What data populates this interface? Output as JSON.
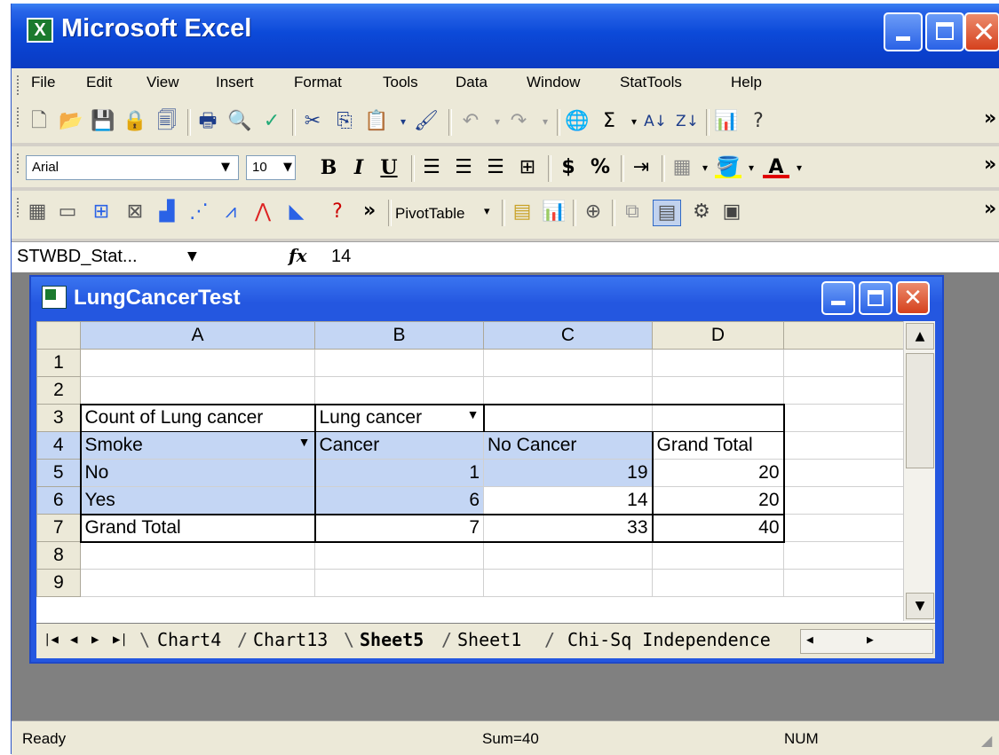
{
  "app": {
    "title": "Microsoft Excel",
    "logo": "X"
  },
  "menu": [
    "File",
    "Edit",
    "View",
    "Insert",
    "Format",
    "Tools",
    "Data",
    "Window",
    "StatTools",
    "Help"
  ],
  "toolbar2": {
    "font": "Arial",
    "size": "10",
    "bold": "B",
    "italic": "I",
    "underline": "U",
    "currency": "$",
    "percent": "%"
  },
  "toolbar3": {
    "pivot_label": "PivotTable"
  },
  "formula_bar": {
    "name_box": "STWBD_Stat...",
    "fx": "fx",
    "value": "14"
  },
  "workbook": {
    "title": "LungCancerTest"
  },
  "columns": [
    "A",
    "B",
    "C",
    "D"
  ],
  "rows": [
    {
      "n": "1",
      "a": "",
      "b": "",
      "c": "",
      "d": ""
    },
    {
      "n": "2",
      "a": "",
      "b": "",
      "c": "",
      "d": ""
    },
    {
      "n": "3",
      "a": "Count of Lung cancer",
      "b": "Lung cancer",
      "c": "",
      "d": ""
    },
    {
      "n": "4",
      "a": "Smoke",
      "b": "Cancer",
      "c": "No Cancer",
      "d": "Grand Total"
    },
    {
      "n": "5",
      "a": "No",
      "b": "1",
      "c": "19",
      "d": "20"
    },
    {
      "n": "6",
      "a": "Yes",
      "b": "6",
      "c": "14",
      "d": "20"
    },
    {
      "n": "7",
      "a": "Grand Total",
      "b": "7",
      "c": "33",
      "d": "40"
    },
    {
      "n": "8",
      "a": "",
      "b": "",
      "c": "",
      "d": ""
    },
    {
      "n": "9",
      "a": "",
      "b": "",
      "c": "",
      "d": ""
    }
  ],
  "sheet_tabs": [
    "Chart4",
    "Chart13",
    "Sheet5",
    "Sheet1",
    "Chi-Sq Independence"
  ],
  "active_tab": "Sheet5",
  "status": {
    "ready": "Ready",
    "sum": "Sum=40",
    "num": "NUM"
  }
}
